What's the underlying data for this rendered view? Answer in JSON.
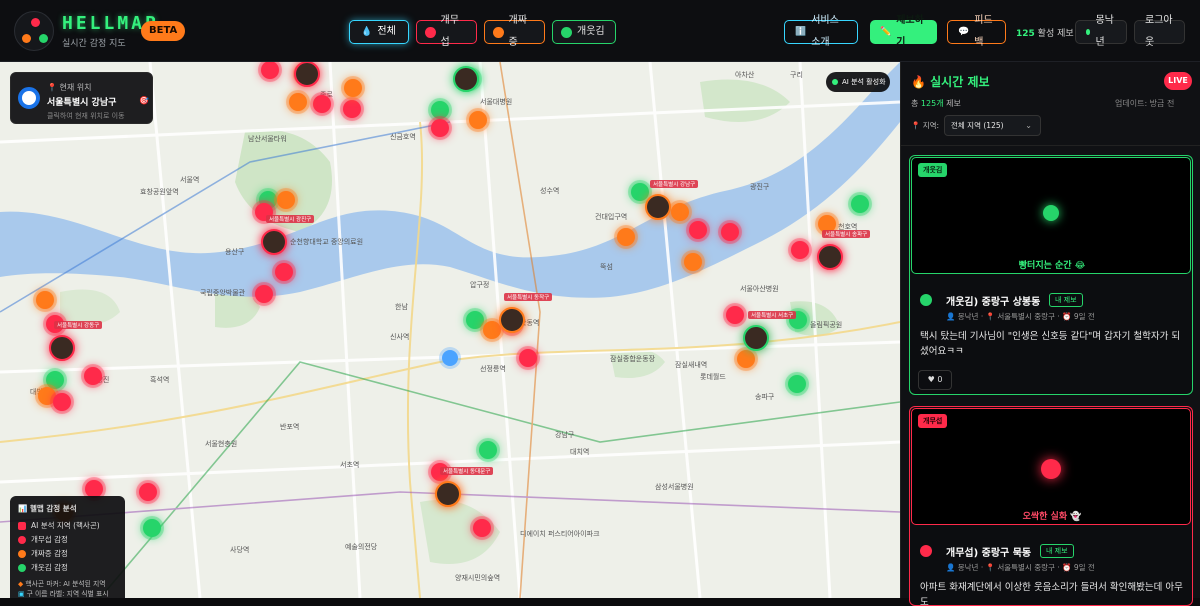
{
  "header": {
    "brand_title": "HELLMAP",
    "brand_subtitle": "실시간 감정 지도",
    "beta_label": "BETA",
    "filter_tabs": [
      {
        "label": "전체",
        "color": "#37d6ff",
        "active": true
      },
      {
        "label": "개무섭",
        "color": "#ff2a4a",
        "active": false
      },
      {
        "label": "개짜증",
        "color": "#ff7a1a",
        "active": false
      },
      {
        "label": "개웃김",
        "color": "#26d46a",
        "active": false
      }
    ],
    "about_label": "서비스 소개",
    "report_label": "제보하기",
    "feedback_label": "피드백",
    "active_count": "125",
    "active_suffix": "활성 제보",
    "user_name": "몽낙년",
    "logout_label": "로그아웃"
  },
  "map": {
    "location_title": "현재 위치",
    "location_value": "서울특별시 강남구",
    "location_hint": "클릭하여 현재 위치로 이동",
    "ai_badge": "AI 분석 활성화",
    "legend_title": "헬맵 감정 분석",
    "legend_items": [
      {
        "label": "AI 분석 지역 (핵사곤)",
        "color": "#ff2a4a"
      },
      {
        "label": "개무섭 감정",
        "color": "#ff2a4a"
      },
      {
        "label": "개짜증 감정",
        "color": "#ff7a1a"
      },
      {
        "label": "개웃김 감정",
        "color": "#26d46a"
      }
    ],
    "legend_note1": "핵사곤 마커: AI 분석된 지역",
    "legend_note2": "구 이름 라벨: 지역 식별 표시",
    "place_labels": [
      "남산서울타워",
      "서울역",
      "용산구",
      "순천향대학교 중앙의료원",
      "한남",
      "압구정",
      "신사역",
      "잠실종합운동장",
      "송파구",
      "강남구",
      "서초역",
      "예술의전당",
      "올림픽공원",
      "광진구",
      "성수역",
      "건대입구역",
      "뚝섬",
      "롯데월드",
      "서울아산병원",
      "아차산",
      "구리",
      "중랑구",
      "효창공원앞역",
      "국립중앙박물관",
      "흑석역",
      "서울현충원",
      "대방역",
      "노량진",
      "사당역",
      "양재시민의숲역",
      "삼성서울병원",
      "디에이치 퍼스티어아이파크",
      "서울대병원",
      "종로",
      "신금호역",
      "반포역",
      "선정릉역",
      "학동역",
      "대치역",
      "잠실새내역",
      "천호역"
    ],
    "tooltip_labels": [
      "서울특별시 중구",
      "서울특별시 용산구",
      "서울특별시 광진구",
      "서울특별시 강남구",
      "서울특별시 송파구",
      "서울특별시 강동구",
      "서울특별시 동작구",
      "서울특별시 서초구",
      "서울특별시 동대문구"
    ]
  },
  "panel": {
    "title": "실시간 제보",
    "live_label": "LIVE",
    "total_prefix": "총",
    "total_count": "125개",
    "total_suffix": "제보",
    "updated": "업데이트: 방금 전",
    "region_label": "지역:",
    "region_value": "전체 지역 (125)",
    "cards": [
      {
        "tag": "개웃김",
        "color": "#26d46a",
        "caption": "빵터지는 순간 😂",
        "title": "개웃김) 중랑구 상봉동",
        "badge": "내 제보",
        "author": "몽낙년",
        "location": "서울특별시 중랑구",
        "time": "9일 전",
        "body": "택시 탔는데 기사님이 \"인생은 신호등 같다\"며 갑자기 철학자가 되셨어요ㅋㅋ",
        "likes": "0"
      },
      {
        "tag": "개무섭",
        "color": "#ff2a4a",
        "caption": "오싹한 실화 👻",
        "title": "개무섭) 중랑구 묵동",
        "badge": "내 제보",
        "author": "몽낙년",
        "location": "서울특별시 중랑구",
        "time": "9일 전",
        "body": "아파트 화재계단에서 이상한 웃음소리가 들려서 확인해봤는데 아무도"
      }
    ]
  }
}
